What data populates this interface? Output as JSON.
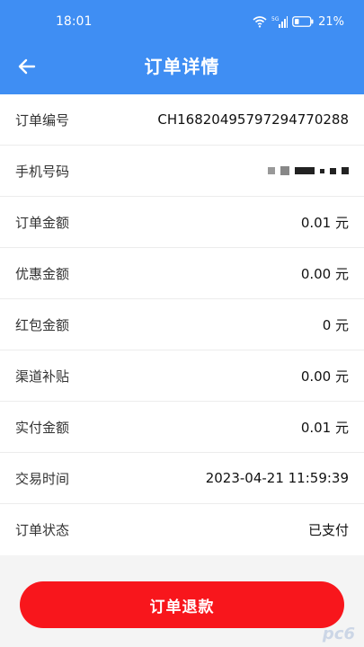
{
  "status_bar": {
    "time": "18:01",
    "battery": "21%"
  },
  "header": {
    "title": "订单详情"
  },
  "rows": [
    {
      "label": "订单编号",
      "value": "CH16820495797294770288"
    },
    {
      "label": "手机号码",
      "value": ""
    },
    {
      "label": "订单金额",
      "value": "0.01 元"
    },
    {
      "label": "优惠金额",
      "value": "0.00 元"
    },
    {
      "label": "红包金额",
      "value": "0 元"
    },
    {
      "label": "渠道补贴",
      "value": "0.00 元"
    },
    {
      "label": "实付金额",
      "value": "0.01 元"
    },
    {
      "label": "交易时间",
      "value": "2023-04-21 11:59:39"
    },
    {
      "label": "订单状态",
      "value": "已支付"
    }
  ],
  "refund_button": {
    "label": "订单退款"
  },
  "watermark": {
    "text": "pc6"
  },
  "colors": {
    "header_bg": "#3f8ef3",
    "button_bg": "#f8161c"
  }
}
